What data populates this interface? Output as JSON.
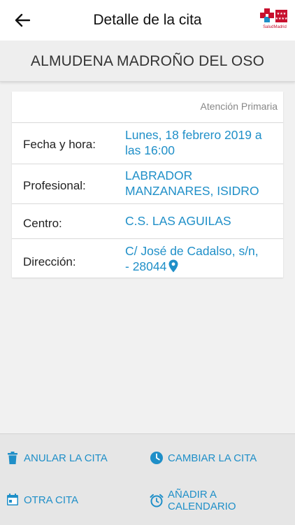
{
  "header": {
    "title": "Detalle de la cita",
    "logo_text": "SaludMadrid"
  },
  "patient": {
    "name": "ALMUDENA MADROÑO DEL OSO"
  },
  "appointment": {
    "service": "Atención Primaria",
    "rows": [
      {
        "label": "Fecha y hora:",
        "value_line1": "Lunes, 18 febrero 2019 a",
        "value_line2": "las 16:00"
      },
      {
        "label": "Profesional:",
        "value_line1": "LABRADOR",
        "value_line2": "MANZANARES, ISIDRO"
      },
      {
        "label": "Centro:",
        "value_line1": "C.S. LAS AGUILAS"
      },
      {
        "label": "Dirección:",
        "value_line1": "C/ José de Cadalso, s/n,",
        "value_line2": "- 28044"
      }
    ]
  },
  "actions": {
    "cancel": "ANULAR LA CITA",
    "change": "CAMBIAR LA CITA",
    "other": "OTRA CITA",
    "calendar_line1": "AÑADIR A",
    "calendar_line2": "CALENDARIO"
  },
  "colors": {
    "accent": "#1f8fc8",
    "brand_red": "#c8102e"
  }
}
